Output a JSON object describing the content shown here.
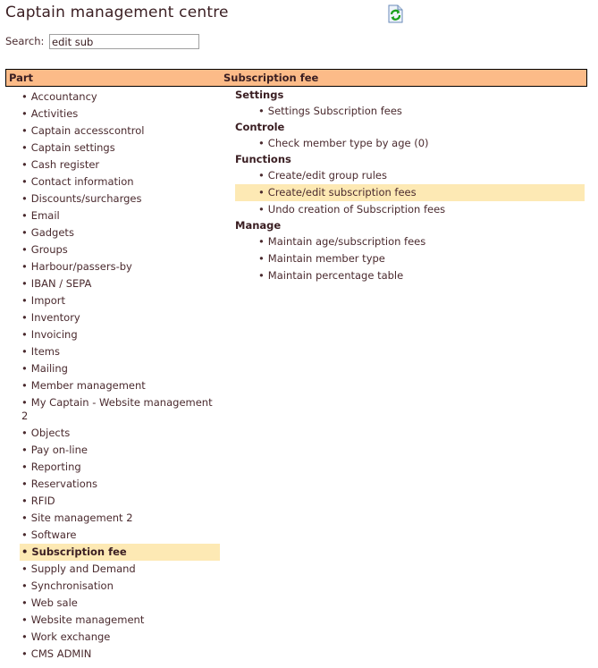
{
  "page": {
    "title": "Captain management centre",
    "refresh_icon": "refresh-icon"
  },
  "search": {
    "label": "Search:",
    "value": "edit sub",
    "placeholder": ""
  },
  "table_header": {
    "part": "Part",
    "selected_part": "Subscription fee"
  },
  "parts": [
    {
      "label": "Accountancy"
    },
    {
      "label": "Activities"
    },
    {
      "label": "Captain accesscontrol"
    },
    {
      "label": "Captain settings"
    },
    {
      "label": "Cash register"
    },
    {
      "label": "Contact information"
    },
    {
      "label": "Discounts/surcharges"
    },
    {
      "label": "Email"
    },
    {
      "label": "Gadgets"
    },
    {
      "label": "Groups"
    },
    {
      "label": "Harbour/passers-by"
    },
    {
      "label": "IBAN / SEPA"
    },
    {
      "label": "Import"
    },
    {
      "label": "Inventory"
    },
    {
      "label": "Invoicing"
    },
    {
      "label": "Items"
    },
    {
      "label": "Mailing"
    },
    {
      "label": "Member management"
    },
    {
      "label": "My Captain - Website management 2"
    },
    {
      "label": "Objects"
    },
    {
      "label": "Pay on-line"
    },
    {
      "label": "Reporting"
    },
    {
      "label": "Reservations"
    },
    {
      "label": "RFID"
    },
    {
      "label": "Site management 2"
    },
    {
      "label": "Software"
    },
    {
      "label": "Subscription fee",
      "active": true
    },
    {
      "label": "Supply and Demand"
    },
    {
      "label": "Synchronisation"
    },
    {
      "label": "Web sale"
    },
    {
      "label": "Website management"
    },
    {
      "label": "Work exchange"
    },
    {
      "label": "CMS ADMIN"
    }
  ],
  "groups": [
    {
      "title": "Settings",
      "items": [
        {
          "label": "Settings Subscription fees"
        }
      ]
    },
    {
      "title": "Controle",
      "items": [
        {
          "label": "Check member type by age (0)"
        }
      ]
    },
    {
      "title": "Functions",
      "items": [
        {
          "label": "Create/edit group rules"
        },
        {
          "label": "Create/edit subscription fees",
          "active": true
        },
        {
          "label": "Undo creation of Subscription fees"
        }
      ]
    },
    {
      "title": "Manage",
      "items": [
        {
          "label": "Maintain age/subscription fees"
        },
        {
          "label": "Maintain member type"
        },
        {
          "label": "Maintain percentage table"
        }
      ]
    }
  ],
  "bullet": "•",
  "colors": {
    "header_bg": "#fcbb88",
    "highlight_bg": "#fde9b4",
    "text": "#4a2a2e"
  }
}
